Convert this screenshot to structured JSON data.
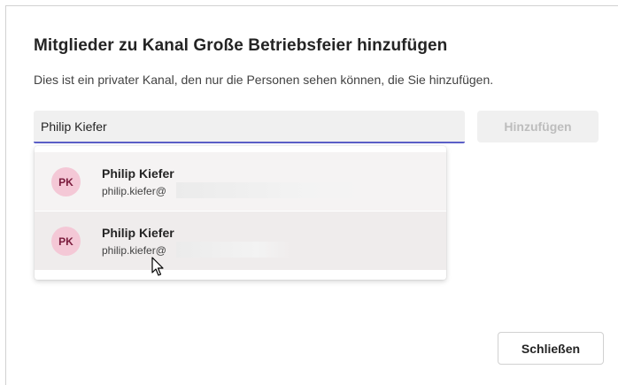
{
  "dialog": {
    "title": "Mitglieder zu Kanal Große Betriebsfeier hinzufügen",
    "subtitle": "Dies ist ein privater Kanal, den nur die Personen sehen können, die Sie hinzufügen."
  },
  "search": {
    "value": "Philip Kiefer"
  },
  "add_button": {
    "label": "Hinzufügen",
    "disabled": true
  },
  "suggestions": [
    {
      "initials": "PK",
      "name": "Philip Kiefer",
      "email": "philip.kiefer@"
    },
    {
      "initials": "PK",
      "name": "Philip Kiefer",
      "email": "philip.kiefer@"
    }
  ],
  "close_button": {
    "label": "Schließen"
  },
  "colors": {
    "accent": "#5b5fc7",
    "avatar_bg": "#f4c8d6",
    "avatar_text": "#7a1b3c"
  }
}
